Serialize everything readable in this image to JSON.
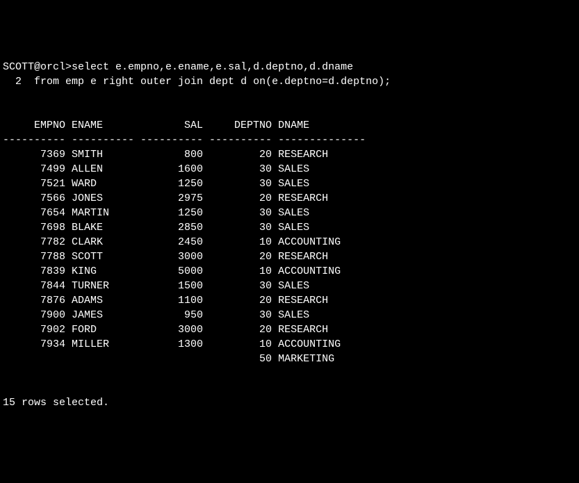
{
  "prompt": {
    "line1_prefix": "SCOTT@orcl>",
    "line1_sql": "select e.empno,e.ename,e.sal,d.deptno,d.dname",
    "line2_prefix": "  2  ",
    "line2_sql": "from emp e right outer join dept d on(e.deptno=d.deptno);"
  },
  "columns": {
    "empno": "EMPNO",
    "ename": "ENAME",
    "sal": "SAL",
    "deptno": "DEPTNO",
    "dname": "DNAME"
  },
  "separators": {
    "empno": "----------",
    "ename": "----------",
    "sal": "----------",
    "deptno": "----------",
    "dname": "--------------"
  },
  "rows": [
    {
      "empno": "7369",
      "ename": "SMITH",
      "sal": "800",
      "deptno": "20",
      "dname": "RESEARCH"
    },
    {
      "empno": "7499",
      "ename": "ALLEN",
      "sal": "1600",
      "deptno": "30",
      "dname": "SALES"
    },
    {
      "empno": "7521",
      "ename": "WARD",
      "sal": "1250",
      "deptno": "30",
      "dname": "SALES"
    },
    {
      "empno": "7566",
      "ename": "JONES",
      "sal": "2975",
      "deptno": "20",
      "dname": "RESEARCH"
    },
    {
      "empno": "7654",
      "ename": "MARTIN",
      "sal": "1250",
      "deptno": "30",
      "dname": "SALES"
    },
    {
      "empno": "7698",
      "ename": "BLAKE",
      "sal": "2850",
      "deptno": "30",
      "dname": "SALES"
    },
    {
      "empno": "7782",
      "ename": "CLARK",
      "sal": "2450",
      "deptno": "10",
      "dname": "ACCOUNTING"
    },
    {
      "empno": "7788",
      "ename": "SCOTT",
      "sal": "3000",
      "deptno": "20",
      "dname": "RESEARCH"
    },
    {
      "empno": "7839",
      "ename": "KING",
      "sal": "5000",
      "deptno": "10",
      "dname": "ACCOUNTING"
    },
    {
      "empno": "7844",
      "ename": "TURNER",
      "sal": "1500",
      "deptno": "30",
      "dname": "SALES"
    },
    {
      "empno": "7876",
      "ename": "ADAMS",
      "sal": "1100",
      "deptno": "20",
      "dname": "RESEARCH"
    },
    {
      "empno": "7900",
      "ename": "JAMES",
      "sal": "950",
      "deptno": "30",
      "dname": "SALES"
    },
    {
      "empno": "7902",
      "ename": "FORD",
      "sal": "3000",
      "deptno": "20",
      "dname": "RESEARCH"
    },
    {
      "empno": "7934",
      "ename": "MILLER",
      "sal": "1300",
      "deptno": "10",
      "dname": "ACCOUNTING"
    },
    {
      "empno": "",
      "ename": "",
      "sal": "",
      "deptno": "50",
      "dname": "MARKETING"
    }
  ],
  "footer": "15 rows selected."
}
